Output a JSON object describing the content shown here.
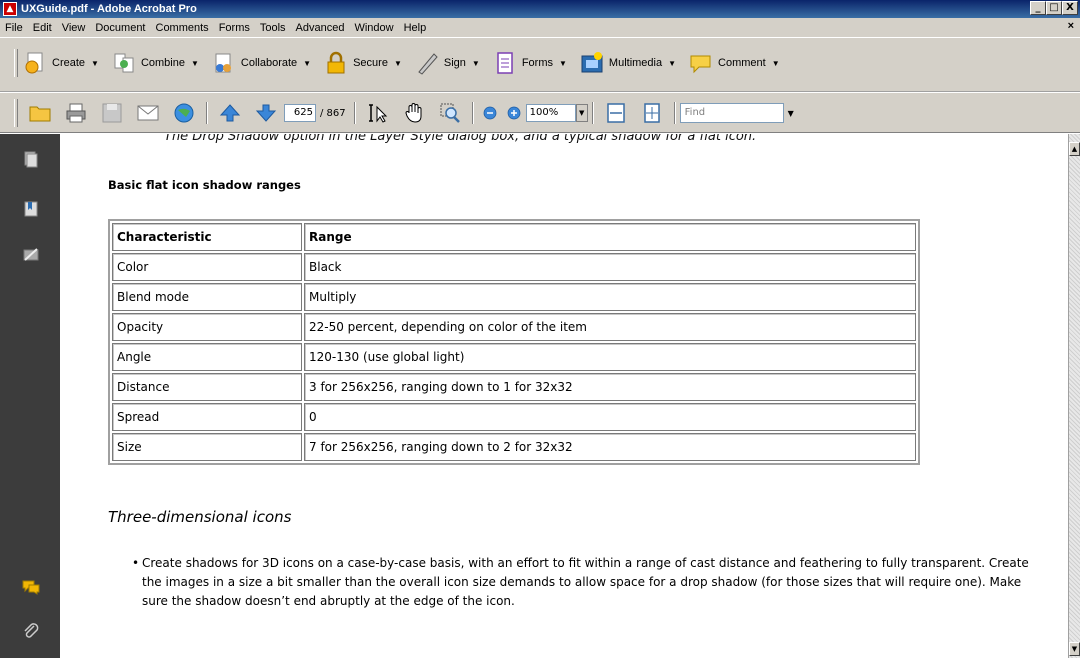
{
  "window": {
    "title": "UXGuide.pdf - Adobe Acrobat Pro",
    "minimize": "_",
    "maximize": "□",
    "close": "X",
    "doc_close": "×"
  },
  "menu": [
    "File",
    "Edit",
    "View",
    "Document",
    "Comments",
    "Forms",
    "Tools",
    "Advanced",
    "Window",
    "Help"
  ],
  "tasks": {
    "create": "Create",
    "combine": "Combine",
    "collaborate": "Collaborate",
    "secure": "Secure",
    "sign": "Sign",
    "forms": "Forms",
    "multimedia": "Multimedia",
    "comment": "Comment"
  },
  "nav": {
    "page_current": "625",
    "page_total": "/ 867",
    "zoom": "100%",
    "find_placeholder": "Find"
  },
  "doc": {
    "caption": "The Drop Shadow option in the Layer Style dialog box, and a typical shadow for a flat icon.",
    "section_title": "Basic flat icon shadow ranges",
    "table": {
      "headers": [
        "Characteristic",
        "Range"
      ],
      "rows": [
        [
          "Color",
          "Black"
        ],
        [
          "Blend mode",
          "Multiply"
        ],
        [
          "Opacity",
          "22-50 percent, depending on color of the item"
        ],
        [
          "Angle",
          "120-130 (use global light)"
        ],
        [
          "Distance",
          "3 for 256x256, ranging down to 1 for 32x32"
        ],
        [
          "Spread",
          "0"
        ],
        [
          "Size",
          "7 for 256x256, ranging down to 2 for 32x32"
        ]
      ]
    },
    "heading2": "Three-dimensional icons",
    "bullet": "Create shadows for 3D icons on a case-by-case basis, with an effort to fit within a range of cast distance and feathering to fully transparent. Create the images in a size a bit smaller than the overall icon size demands to allow space for a drop shadow (for those sizes that will require one). Make sure the shadow doesn’t end abruptly at the edge of the icon."
  }
}
